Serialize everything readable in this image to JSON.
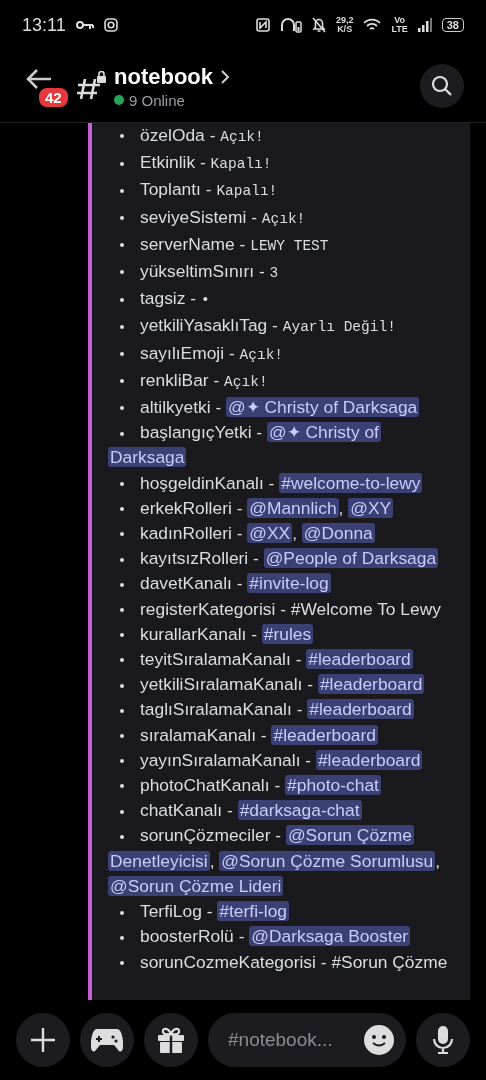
{
  "status_bar": {
    "time": "13:11",
    "speed": "29,2",
    "speed_unit": "K/S",
    "network_top": "Vo",
    "network_bottom": "LTE",
    "battery": "38"
  },
  "header": {
    "unread_badge": "42",
    "title": "notebook",
    "online": "9 Online"
  },
  "separator": "-",
  "settings": [
    {
      "key": "özelOda",
      "parts": [
        {
          "kind": "code",
          "text": "Açık!"
        }
      ]
    },
    {
      "key": "Etkinlik",
      "parts": [
        {
          "kind": "code",
          "text": "Kapalı!"
        }
      ]
    },
    {
      "key": "Toplantı",
      "parts": [
        {
          "kind": "code",
          "text": "Kapalı!"
        }
      ]
    },
    {
      "key": "seviyeSistemi",
      "parts": [
        {
          "kind": "code",
          "text": "Açık!"
        }
      ]
    },
    {
      "key": "serverName",
      "parts": [
        {
          "kind": "code",
          "text": "LEWY TEST"
        }
      ]
    },
    {
      "key": "yükseltimSınırı",
      "parts": [
        {
          "kind": "code",
          "text": "3"
        }
      ]
    },
    {
      "key": "tagsiz",
      "parts": [
        {
          "kind": "code",
          "text": "•"
        }
      ]
    },
    {
      "key": "yetkiliYasaklıTag",
      "parts": [
        {
          "kind": "code",
          "text": " Ayarlı Değil!"
        }
      ]
    },
    {
      "key": "sayılıEmoji",
      "parts": [
        {
          "kind": "code",
          "text": "Açık!"
        }
      ]
    },
    {
      "key": "renkliBar",
      "parts": [
        {
          "kind": "code",
          "text": "Açık!"
        }
      ]
    },
    {
      "key": "altilkyetki",
      "parts": [
        {
          "kind": "mention",
          "text": "@✦ Christy of Darksaga"
        }
      ]
    },
    {
      "key": "başlangıçYetki",
      "parts": [
        {
          "kind": "mention",
          "text": "@✦ Christy of"
        },
        {
          "kind": "mention",
          "text": "Darksaga"
        }
      ]
    },
    {
      "key": "hoşgeldinKanalı",
      "parts": [
        {
          "kind": "mention",
          "text": "#welcome-to-lewy"
        }
      ]
    },
    {
      "key": "erkekRolleri",
      "parts": [
        {
          "kind": "mention",
          "text": "@Mannlich"
        },
        {
          "kind": "plain",
          "text": ", "
        },
        {
          "kind": "mention",
          "text": "@XY"
        }
      ]
    },
    {
      "key": "kadınRolleri",
      "parts": [
        {
          "kind": "mention",
          "text": "@XX"
        },
        {
          "kind": "plain",
          "text": ", "
        },
        {
          "kind": "mention",
          "text": "@Donna"
        }
      ]
    },
    {
      "key": "kayıtsızRolleri",
      "parts": [
        {
          "kind": "mention",
          "text": "@People of Darksaga"
        }
      ]
    },
    {
      "key": "davetKanalı",
      "parts": [
        {
          "kind": "mention",
          "text": "#invite-log"
        }
      ]
    },
    {
      "key": "registerKategorisi",
      "parts": [
        {
          "kind": "plain",
          "text": "#Welcome To Lewy"
        }
      ]
    },
    {
      "key": "kurallarKanalı",
      "parts": [
        {
          "kind": "mention",
          "text": "#rules"
        }
      ]
    },
    {
      "key": "teyitSıralamaKanalı",
      "parts": [
        {
          "kind": "mention",
          "text": "#leaderboard"
        }
      ]
    },
    {
      "key": "yetkiliSıralamaKanalı",
      "parts": [
        {
          "kind": "mention",
          "text": "#leaderboard"
        }
      ]
    },
    {
      "key": "taglıSıralamaKanalı",
      "parts": [
        {
          "kind": "mention",
          "text": "#leaderboard"
        }
      ]
    },
    {
      "key": "sıralamaKanalı",
      "parts": [
        {
          "kind": "mention",
          "text": "#leaderboard"
        }
      ]
    },
    {
      "key": "yayınSıralamaKanalı",
      "parts": [
        {
          "kind": "mention",
          "text": "#leaderboard"
        }
      ]
    },
    {
      "key": "photoChatKanalı",
      "parts": [
        {
          "kind": "mention",
          "text": "#photo-chat"
        }
      ]
    },
    {
      "key": "chatKanalı",
      "parts": [
        {
          "kind": "mention",
          "text": "#darksaga-chat"
        }
      ]
    },
    {
      "key": "sorunÇözmeciler",
      "parts": [
        {
          "kind": "mention",
          "text": "@Sorun Çözme"
        },
        {
          "kind": "mention",
          "text": "Denetleyicisi"
        },
        {
          "kind": "plain",
          "text": ", "
        },
        {
          "kind": "mention",
          "text": "@Sorun Çözme Sorumlusu"
        },
        {
          "kind": "plain",
          "text": ", "
        },
        {
          "kind": "mention",
          "text": "@Sorun Çözme Lideri"
        }
      ]
    },
    {
      "key": "TerfiLog",
      "parts": [
        {
          "kind": "mention",
          "text": "#terfi-log"
        }
      ]
    },
    {
      "key": "boosterRolü",
      "parts": [
        {
          "kind": "mention",
          "text": "@Darksaga Booster"
        }
      ]
    },
    {
      "key": "sorunCozmeKategorisi",
      "parts": [
        {
          "kind": "plain",
          "text": "#Sorun Çözme"
        }
      ]
    }
  ],
  "composer": {
    "placeholder": "#notebook..."
  }
}
